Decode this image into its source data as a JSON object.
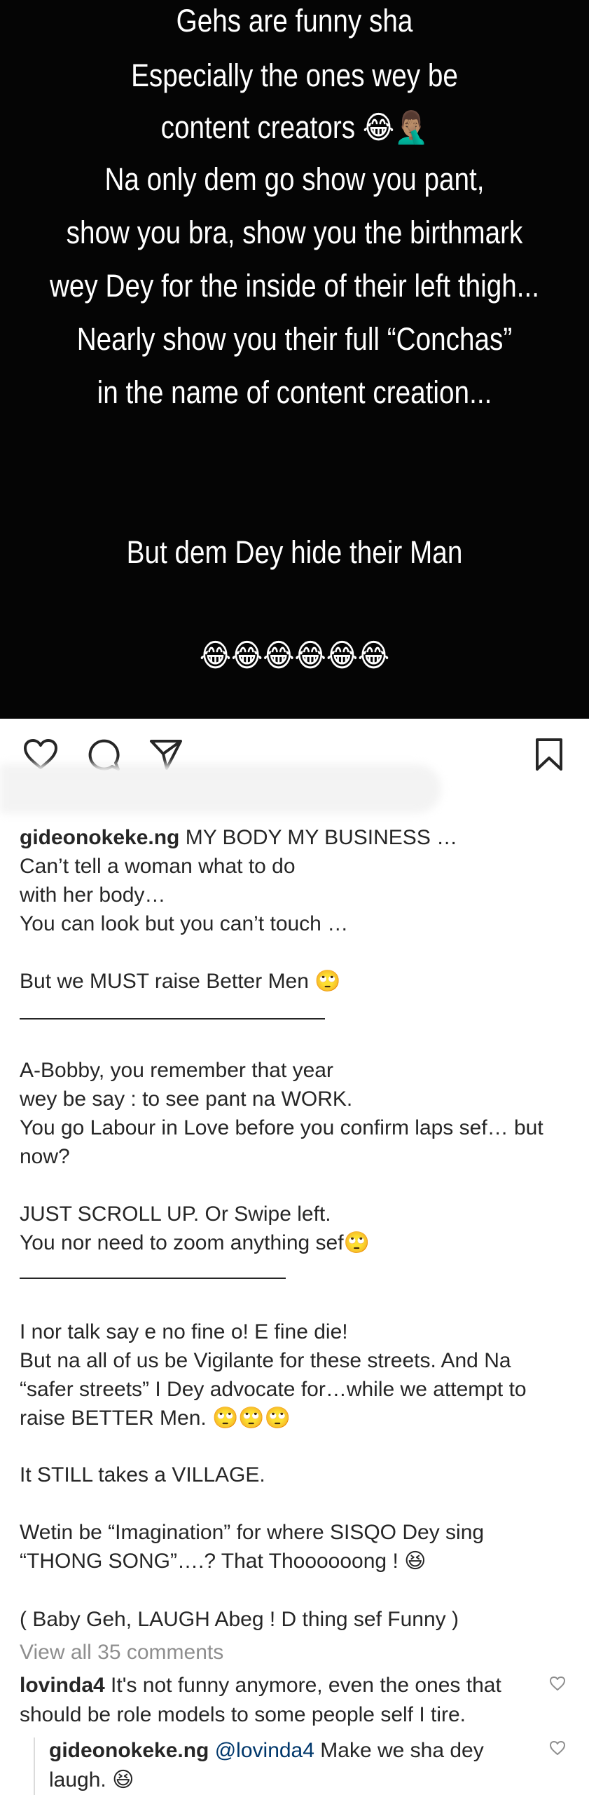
{
  "story": {
    "lines": [
      "Gehs are funny sha",
      "Especially the ones wey be",
      "content creators 😂🤦🏽‍♂️",
      "Na only dem go show you pant,",
      "show you bra, show you the birthmark",
      "wey Dey for the inside of their left thigh...",
      "Nearly show you their full  “Conchas”",
      "in the name of content creation...",
      "But dem Dey hide their Man",
      "😂😂😂😂😂😂"
    ]
  },
  "actions": {
    "like_icon": "heart-icon",
    "comment_icon": "comment-icon",
    "share_icon": "send-icon",
    "save_icon": "bookmark-icon"
  },
  "caption": {
    "username": "gideonokeke.ng",
    "lines": [
      "MY BODY MY BUSINESS …",
      "Can’t tell a woman what to do",
      "with her body…",
      "You can look but you can’t touch …",
      "But we MUST raise Better Men 🙄",
      "A-Bobby, you remember that year",
      "wey be say : to see pant na WORK.",
      "You go Labour in Love before you confirm laps sef… but",
      "now?",
      "JUST SCROLL UP. Or Swipe left.",
      "You nor need to zoom anything sef🙄",
      "I nor talk say e no fine o! E fine die!",
      "But na all of us be Vigilante for these streets. And Na",
      "“safer streets” I Dey advocate for…while we attempt to",
      "raise BETTER Men. 🙄🙄🙄",
      "It STILL takes a VILLAGE.",
      "Wetin be “Imagination” for where SISQO Dey sing",
      "“THONG SONG”….? That Thoooooong ! 😆",
      "( Baby Geh, LAUGH Abeg ! D thing sef Funny )"
    ]
  },
  "view_all": "View all 35 comments",
  "comments": [
    {
      "username": "lovinda4",
      "text_line1": "It's not funny anymore, even the ones that",
      "text_line2": "should be role models to some people self I tire."
    },
    {
      "username": "gideonokeke.ng",
      "mention": "@lovinda4",
      "text_line1": "Make we sha dey",
      "text_line2": "laugh. 😆"
    }
  ]
}
